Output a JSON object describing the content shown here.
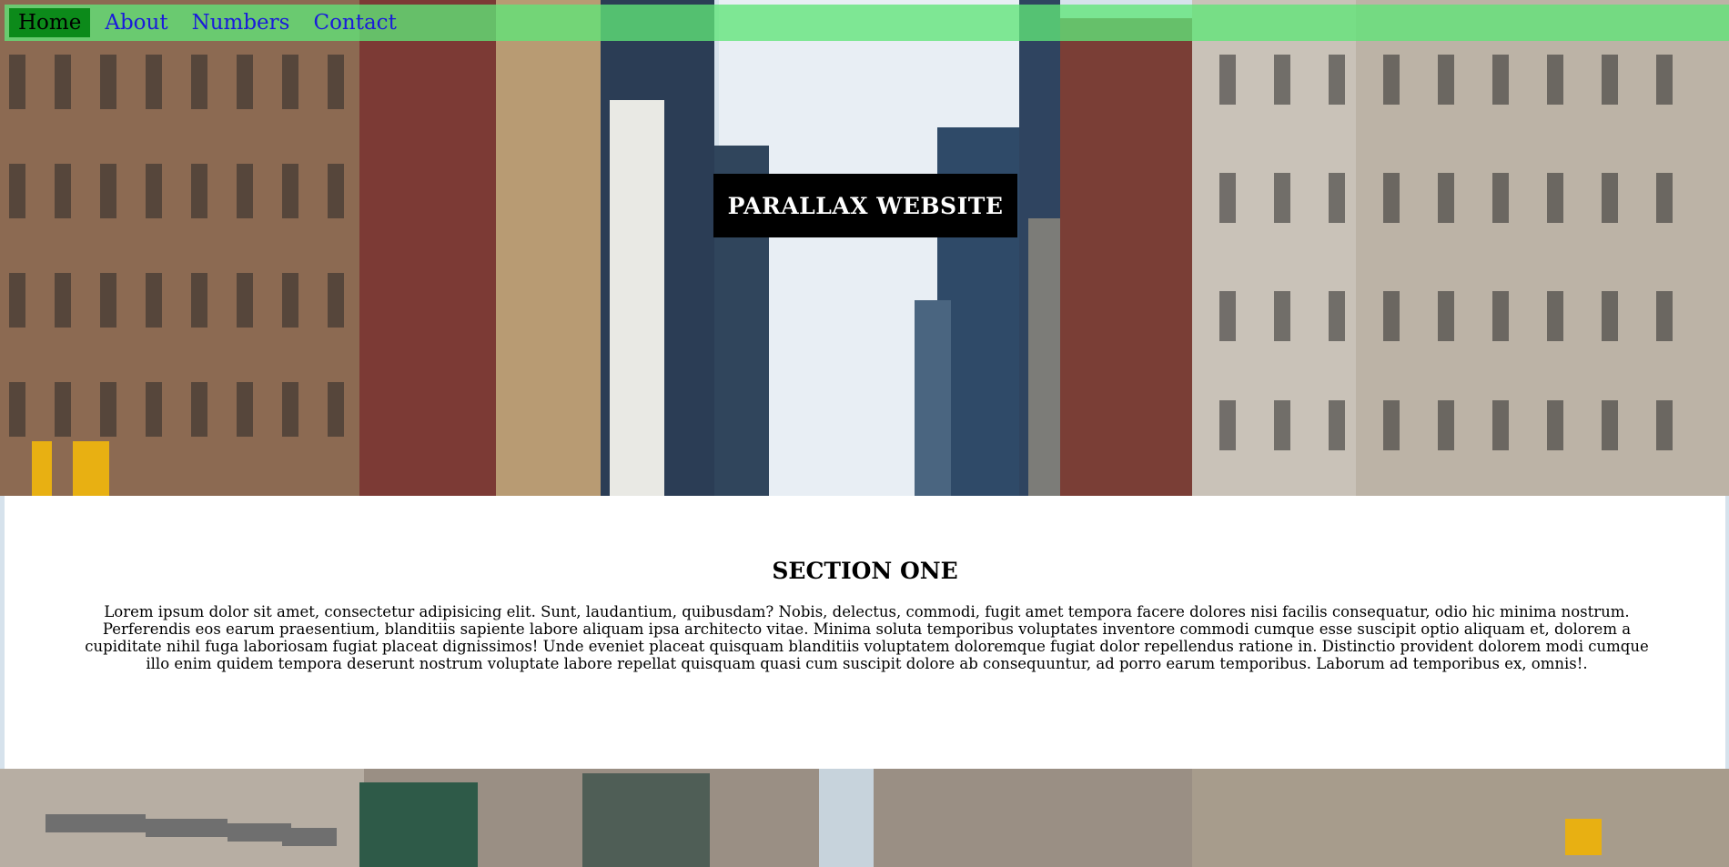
{
  "nav": {
    "items": [
      {
        "label": "Home",
        "active": true
      },
      {
        "label": "About",
        "active": false
      },
      {
        "label": "Numbers",
        "active": false
      },
      {
        "label": "Contact",
        "active": false
      }
    ]
  },
  "hero": {
    "title": "PARALLAX WEBSITE"
  },
  "section_one": {
    "heading": "SECTION ONE",
    "body": "Lorem ipsum dolor sit amet, consectetur adipisicing elit. Sunt, laudantium, quibusdam? Nobis, delectus, commodi, fugit amet tempora facere dolores nisi facilis consequatur, odio hic minima nostrum. Perferendis eos earum praesentium, blanditiis sapiente labore aliquam ipsa architecto vitae. Minima soluta temporibus voluptates inventore commodi cumque esse suscipit optio aliquam et, dolorem a cupiditate nihil fuga laboriosam fugiat placeat dignissimos! Unde eveniet placeat quisquam blanditiis voluptatem doloremque fugiat dolor repellendus ratione in. Distinctio provident dolorem modi cumque illo enim quidem tempora deserunt nostrum voluptate labore repellat quisquam quasi cum suscipit dolore ab consequuntur, ad porro earum temporibus. Laborum ad temporibus ex, omnis!."
  },
  "colors": {
    "nav_bg": "#60e678",
    "nav_active_bg": "#0c8a1a",
    "link": "#1a1adb",
    "title_bg": "#000000"
  }
}
